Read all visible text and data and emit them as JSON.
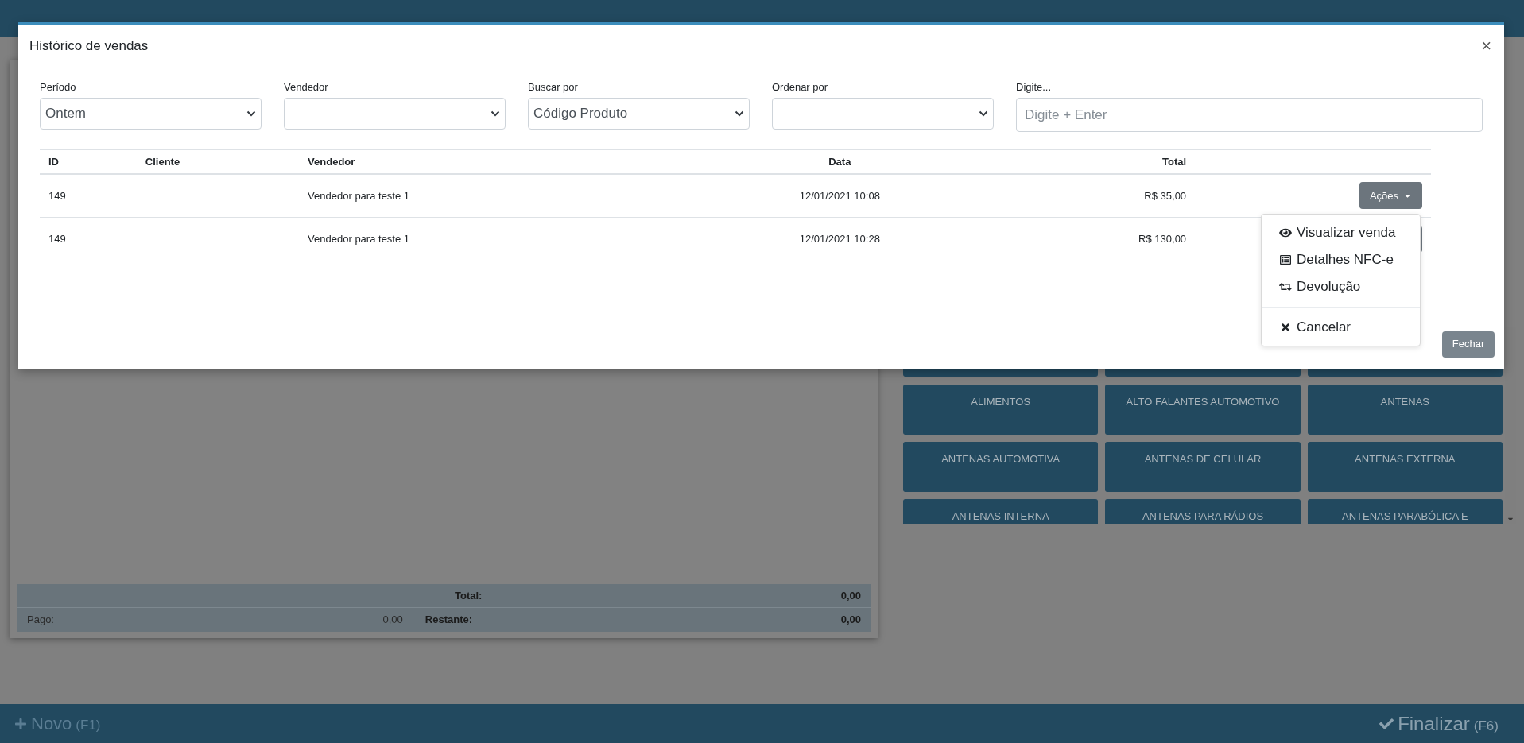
{
  "modal": {
    "title": "Histórico de vendas",
    "close": "×",
    "filters": [
      {
        "label": "Período",
        "kind": "select",
        "value": "Ontem"
      },
      {
        "label": "Vendedor",
        "kind": "select"
      },
      {
        "label": "Buscar por",
        "kind": "select",
        "value": "Código Produto"
      },
      {
        "label": "Ordenar por",
        "kind": "select"
      },
      {
        "label": "Digite...",
        "kind": "input",
        "placeholder": "Digite + Enter"
      }
    ],
    "table": {
      "columns": [
        "ID",
        "Cliente",
        "Vendedor",
        "Data",
        "Total"
      ],
      "rows": [
        {
          "id": "149",
          "seller": "Vendedor para teste 1",
          "date": "12/01/2021 10:08",
          "total": "R$ 35,00",
          "actions": "Ações"
        },
        {
          "id": "149",
          "seller": "Vendedor para teste 1",
          "date": "12/01/2021 10:28",
          "total": "R$ 130,00"
        }
      ]
    },
    "actions_menu": [
      {
        "label": "Visualizar venda",
        "divider_before": false
      },
      {
        "label": "Detalhes NFC-e",
        "divider_before": false
      },
      {
        "label": "Devolução",
        "divider_before": false
      },
      {
        "label": "Cancelar",
        "divider_before": true
      }
    ],
    "close_button": "Fechar"
  },
  "totals": {
    "total_label": "Total:",
    "total": "0,00",
    "paid_label": "Pago:",
    "paid": "0,00",
    "remaining_label": "Restante:",
    "remaining": "0,00"
  },
  "categories": [
    "ALIMENTOS",
    "ALTO FALANTES AUTOMOTIVO",
    "ANTENAS",
    "ANTENAS AUTOMOTIVA",
    "ANTENAS DE CELULAR",
    "ANTENAS EXTERNA",
    "ANTENAS INTERNA",
    "ANTENAS PARA RÁDIOS",
    "ANTENAS PARABÓLICA E"
  ],
  "bottom_bar": {
    "new": "Novo",
    "new_key": "(F1)",
    "finish": "Finalizar",
    "finish_key": "(F6)"
  }
}
